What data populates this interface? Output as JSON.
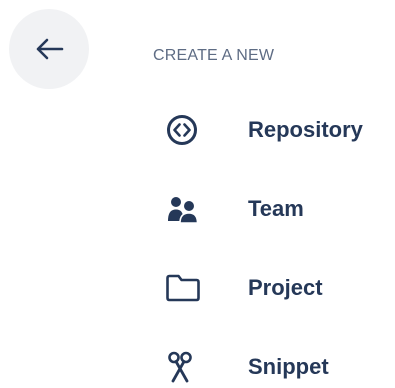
{
  "header": {
    "back_icon": "arrow-left-icon"
  },
  "create_menu": {
    "heading": "CREATE A NEW",
    "items": [
      {
        "label": "Repository",
        "icon": "repository-icon"
      },
      {
        "label": "Team",
        "icon": "team-icon"
      },
      {
        "label": "Project",
        "icon": "folder-icon"
      },
      {
        "label": "Snippet",
        "icon": "scissors-icon"
      }
    ]
  },
  "colors": {
    "text_primary": "#253858",
    "text_secondary": "#5e6c84",
    "back_button_bg": "#f1f2f4"
  }
}
